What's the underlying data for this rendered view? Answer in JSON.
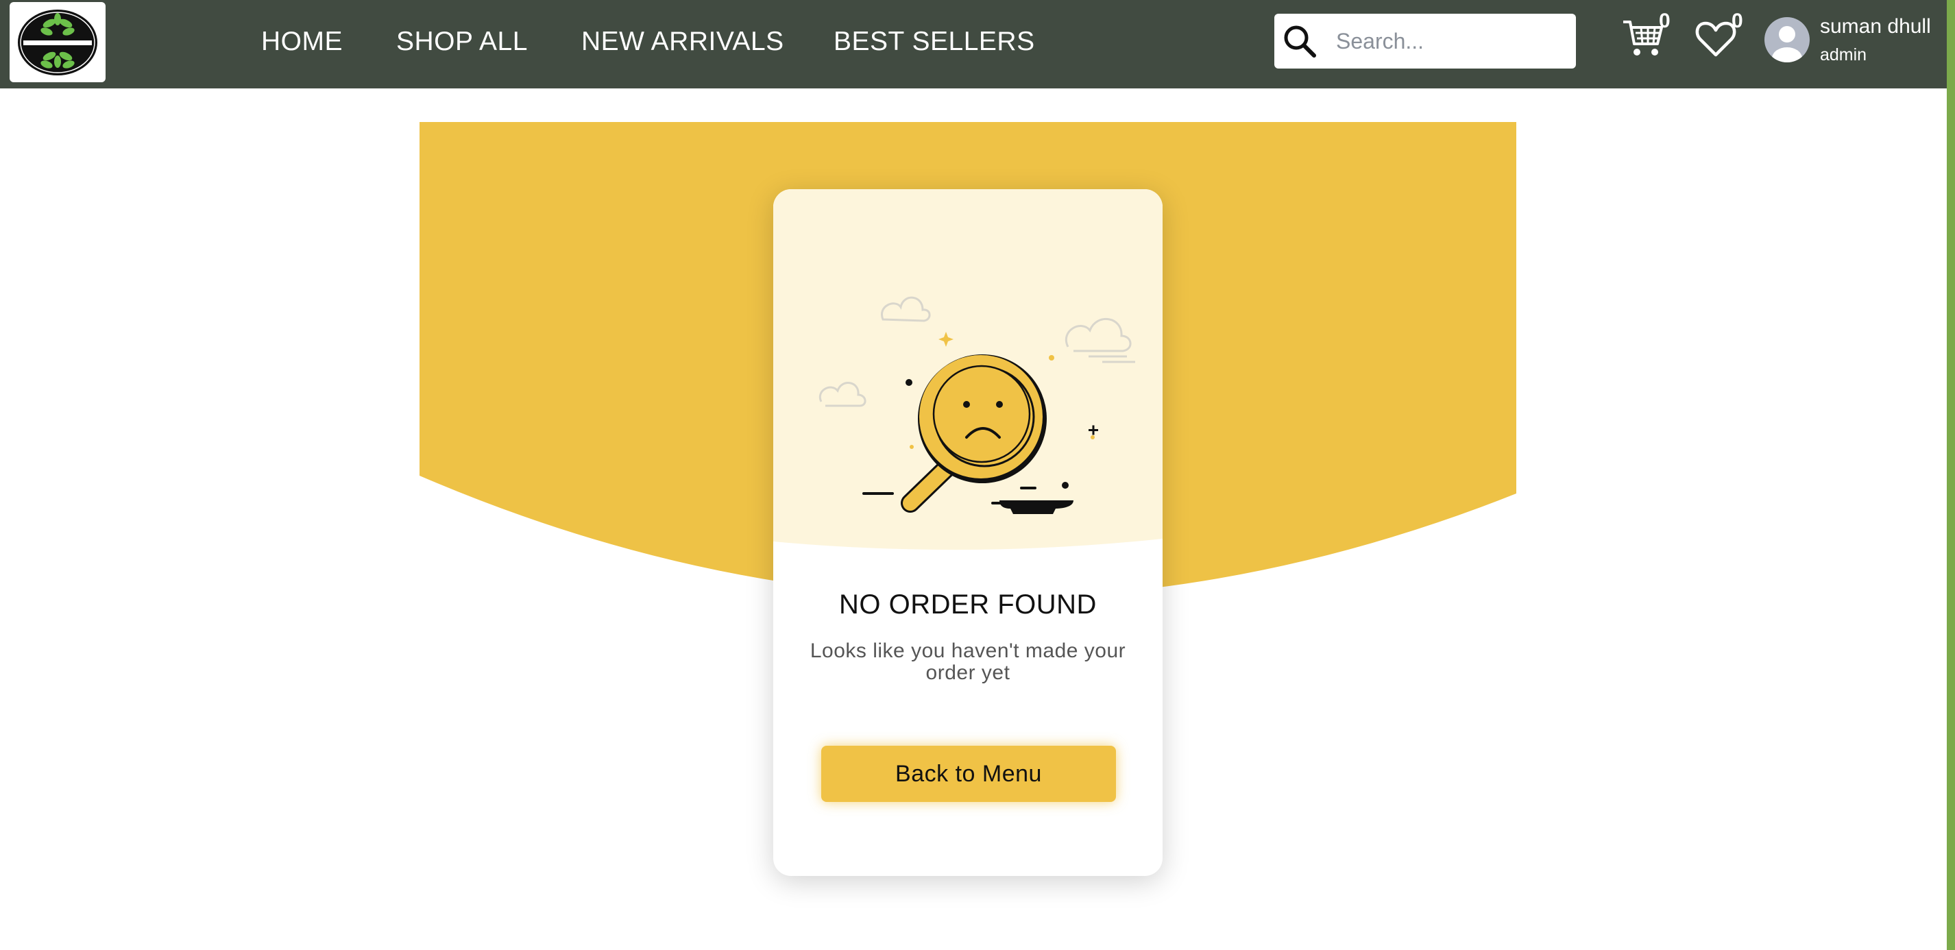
{
  "colors": {
    "navbar": "#414b41",
    "accent_green": "#7caa4b",
    "hero_yellow": "#eec246",
    "card_top": "#fdf5dc",
    "button_yellow": "#f0c246"
  },
  "nav": {
    "links": [
      {
        "label": "HOME"
      },
      {
        "label": "SHOP ALL"
      },
      {
        "label": "NEW ARRIVALS"
      },
      {
        "label": "BEST SELLERS"
      }
    ]
  },
  "search": {
    "placeholder": "Search...",
    "value": "",
    "icon": "search-icon"
  },
  "header_icons": {
    "cart": {
      "icon": "cart-icon",
      "count": "0"
    },
    "wishlist": {
      "icon": "heart-icon",
      "count": "0"
    }
  },
  "user": {
    "name": "suman dhull",
    "role": "admin",
    "icon": "avatar-icon"
  },
  "empty_state": {
    "title": "NO ORDER FOUND",
    "subtitle": "Looks like you haven't made your order yet",
    "button_label": "Back to Menu",
    "illustration": "sad-magnifier-icon"
  }
}
